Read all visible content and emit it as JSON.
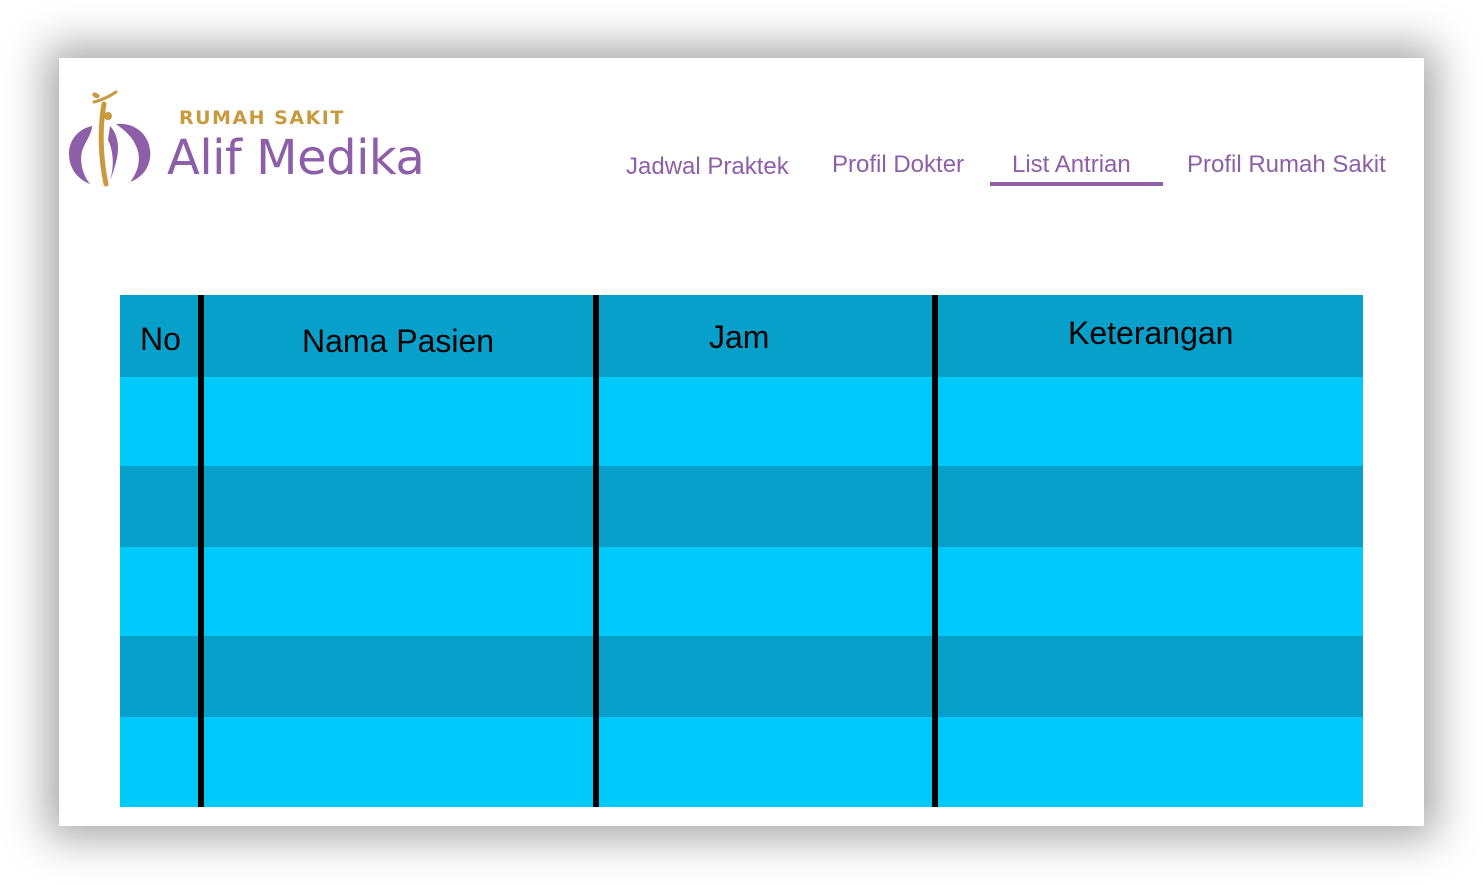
{
  "brand": {
    "top_label": "RUMAH SAKIT",
    "name": "Alif Medika",
    "colors": {
      "purple": "#8d5fa8",
      "gold": "#c89a3d"
    }
  },
  "nav": {
    "items": [
      {
        "label": "Jadwal Praktek",
        "active": false
      },
      {
        "label": "Profil Dokter",
        "active": false
      },
      {
        "label": "List Antrian",
        "active": true
      },
      {
        "label": "Profil Rumah Sakit",
        "active": false
      }
    ]
  },
  "table": {
    "headers": [
      "No",
      "Nama Pasien",
      "Jam",
      "Keterangan"
    ],
    "rows": [
      [
        "",
        "",
        "",
        ""
      ],
      [
        "",
        "",
        "",
        ""
      ],
      [
        "",
        "",
        "",
        ""
      ],
      [
        "",
        "",
        "",
        ""
      ],
      [
        "",
        "",
        "",
        ""
      ]
    ],
    "colors": {
      "header": "#06a0cb",
      "row_light": "#00c9fc",
      "row_dark": "#06a0cb",
      "divider": "#000000"
    }
  }
}
